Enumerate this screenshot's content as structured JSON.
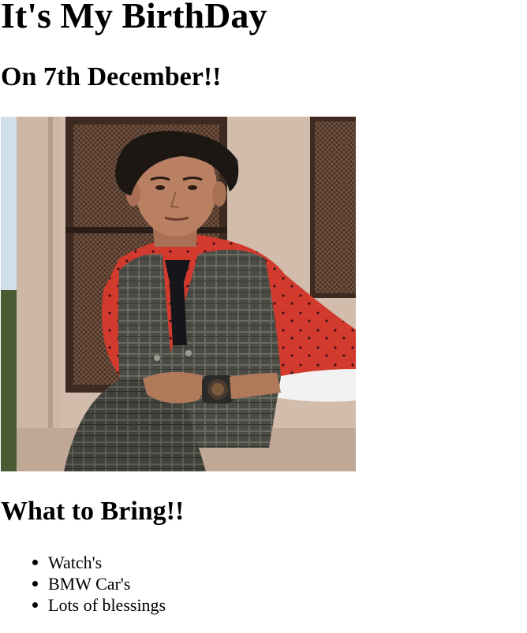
{
  "page": {
    "title": "It's My BirthDay",
    "subtitle": "On 7th December!!",
    "photo_icon": "birthday-person-photo",
    "bring_heading": "What to Bring!!",
    "bring_items": [
      "Watch's",
      "BMW Car's",
      "Lots of blessings"
    ]
  }
}
